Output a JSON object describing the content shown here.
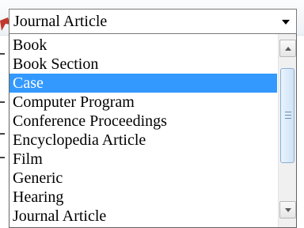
{
  "select": {
    "value": "Journal Article"
  },
  "options": [
    {
      "label": "Book",
      "selected": false
    },
    {
      "label": "Book Section",
      "selected": false
    },
    {
      "label": "Case",
      "selected": true
    },
    {
      "label": "Computer Program",
      "selected": false
    },
    {
      "label": "Conference Proceedings",
      "selected": false
    },
    {
      "label": "Encyclopedia Article",
      "selected": false
    },
    {
      "label": "Film",
      "selected": false
    },
    {
      "label": "Generic",
      "selected": false
    },
    {
      "label": "Hearing",
      "selected": false
    },
    {
      "label": "Journal Article",
      "selected": false
    }
  ],
  "colors": {
    "highlight": "#3399ff",
    "pointer": "#c0392b"
  },
  "icons": {
    "caret": "chevron-down-icon",
    "scroll_up": "arrow-up-icon",
    "scroll_down": "arrow-down-icon"
  }
}
